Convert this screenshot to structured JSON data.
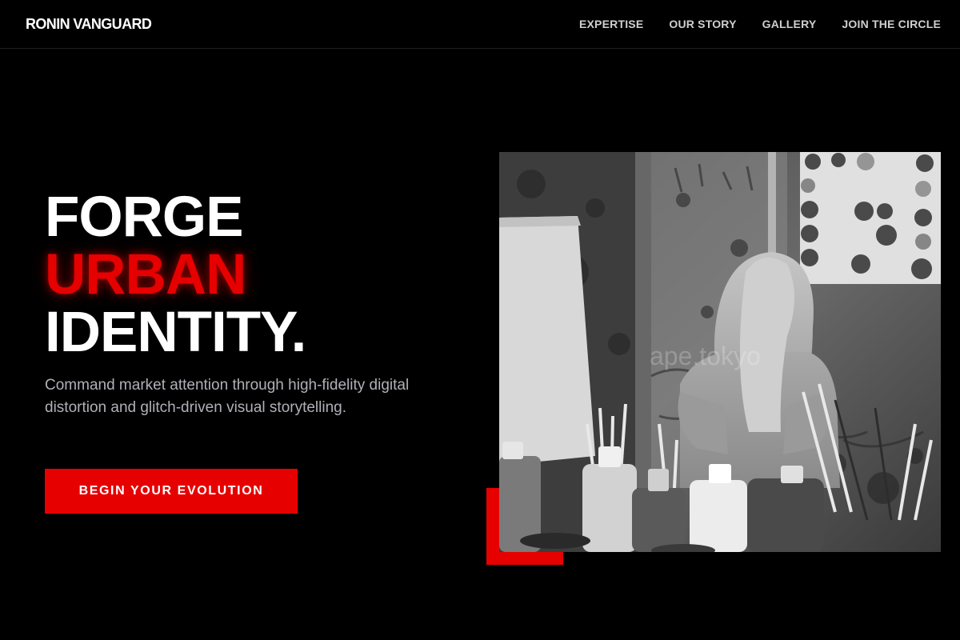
{
  "header": {
    "brand": "RONIN VANGUARD",
    "nav": [
      {
        "label": "EXPERTISE"
      },
      {
        "label": "OUR STORY"
      },
      {
        "label": "GALLERY"
      },
      {
        "label": "JOIN THE CIRCLE"
      }
    ]
  },
  "hero": {
    "headline": {
      "line1": "FORGE",
      "line2": "URBAN",
      "line3": "IDENTITY."
    },
    "subcopy": "Command market attention through high-fidelity digital distortion and glitch-driven visual storytelling.",
    "cta_label": "BEGIN YOUR EVOLUTION",
    "image": {
      "watermark": "ape.tokyo"
    }
  },
  "colors": {
    "background": "#000000",
    "accent": "#e60000",
    "text": "#ffffff",
    "muted_text": "#b0b0b8"
  }
}
